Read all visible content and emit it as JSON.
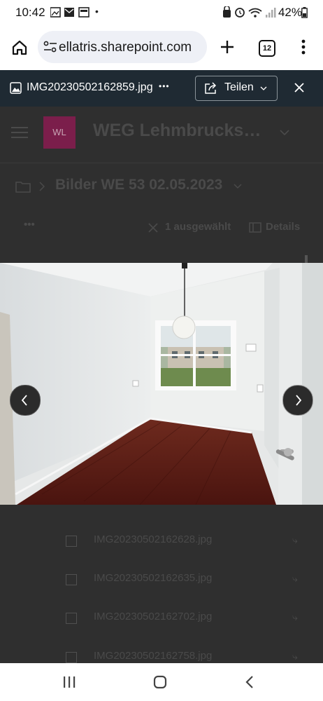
{
  "status": {
    "time": "10:42",
    "dot": "•",
    "battery": "42%"
  },
  "browser": {
    "url": "ellatris.sharepoint.com",
    "tabs": "12"
  },
  "viewer": {
    "filename": "IMG20230502162859.jpg",
    "more": "•••",
    "share_label": "Teilen"
  },
  "site": {
    "logo_text": "WL",
    "title": "WEG Lehmbrucks…"
  },
  "breadcrumb": {
    "folder": "Bilder WE 53 02.05.2023"
  },
  "commands": {
    "more": "•••",
    "selected": "1 ausgewählt",
    "details": "Details"
  },
  "files": [
    "IMG20230502162628.jpg",
    "IMG20230502162635.jpg",
    "IMG20230502162702.jpg",
    "IMG20230502162758.jpg"
  ],
  "colors": {
    "viewer_header": "#1f2a33",
    "logo": "#7b1e4b",
    "floor": "#5a1a14"
  }
}
